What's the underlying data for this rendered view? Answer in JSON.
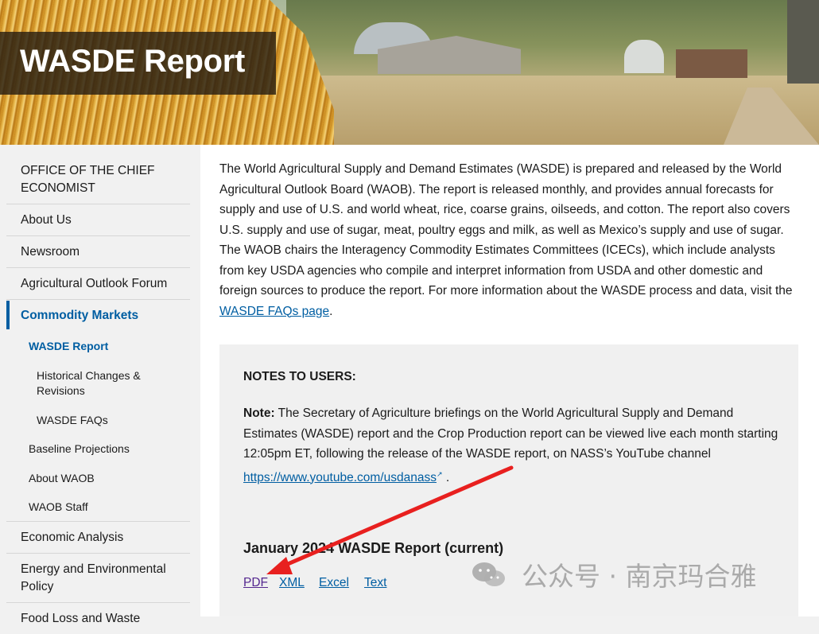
{
  "header": {
    "title": "WASDE Report"
  },
  "sidebar": {
    "items": [
      {
        "label": "OFFICE OF THE CHIEF ECONOMIST"
      },
      {
        "label": "About Us"
      },
      {
        "label": "Newsroom"
      },
      {
        "label": "Agricultural Outlook Forum"
      },
      {
        "label": "Commodity Markets"
      },
      {
        "label": "Economic Analysis"
      },
      {
        "label": "Energy and Environmental Policy"
      },
      {
        "label": "Food Loss and Waste"
      }
    ],
    "subitems": {
      "wasde_report": "WASDE Report",
      "historical": "Historical Changes & Revisions",
      "wasde_faqs": "WASDE FAQs",
      "baseline": "Baseline Projections",
      "about_waob": "About WAOB",
      "waob_staff": "WAOB Staff"
    }
  },
  "main": {
    "intro_text": "The World Agricultural Supply and Demand Estimates (WASDE) is prepared and released by the World Agricultural Outlook Board (WAOB). The report is released monthly, and provides annual forecasts for supply and use of U.S. and world wheat, rice, coarse grains, oilseeds, and cotton. The report also covers U.S. supply and use of sugar, meat, poultry eggs and milk, as well as Mexico’s supply and use of sugar. The WAOB chairs the Interagency Commodity Estimates Committees (ICECs), which include analysts from key USDA agencies who compile and interpret information from USDA and other domestic and foreign sources to produce the report. For more information about the WASDE process and data, visit the",
    "faq_link": "WASDE FAQs page",
    "intro_end": "."
  },
  "notes": {
    "heading": "NOTES TO USERS:",
    "note_label": "Note:",
    "note_text": "The Secretary of Agriculture briefings on the World Agricultural Supply and Demand Estimates (WASDE) report and the Crop Production report can be viewed live each month starting 12:05pm ET, following the release of the WASDE report, on NASS’s YouTube channel",
    "youtube_link": "https://www.youtube.com/usdanass",
    "note_end": ".",
    "report_heading": "January 2024 WASDE Report (current)",
    "downloads": [
      "PDF",
      "XML",
      "Excel",
      "Text"
    ]
  },
  "watermark": {
    "text": "公众号 · 南京玛合雅"
  },
  "colors": {
    "link": "#005ea2",
    "visited": "#54278f",
    "arrow": "#e8201f",
    "sidebar_bg": "#f1f1f1"
  }
}
